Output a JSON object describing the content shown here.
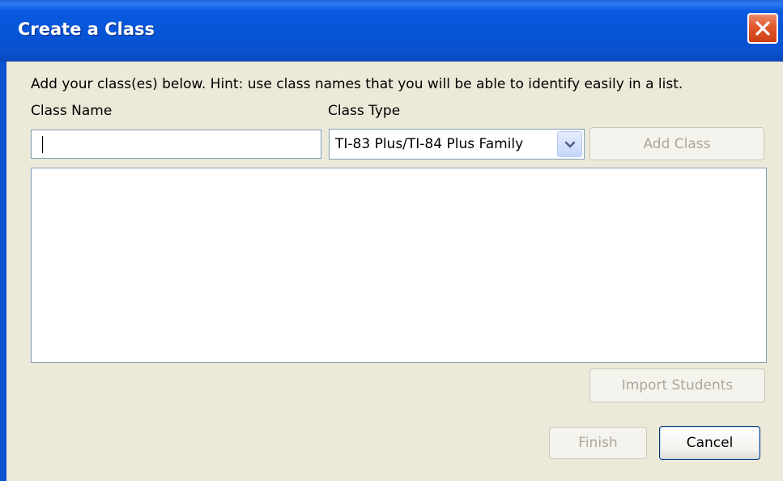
{
  "window": {
    "title": "Create a Class"
  },
  "form": {
    "hint": "Add your class(es) below.  Hint: use class names that you will be able to identify easily in a list.",
    "class_name_label": "Class Name",
    "class_name_value": "",
    "class_type_label": "Class Type",
    "class_type_selected": "TI-83 Plus/TI-84 Plus Family",
    "add_class_button": "Add Class"
  },
  "class_list": {
    "items": []
  },
  "buttons": {
    "import_students": "Import Students",
    "finish": "Finish",
    "cancel": "Cancel"
  },
  "colors": {
    "titlebar": "#0654d6",
    "client_bg": "#ece9d8",
    "close": "#e0582c",
    "disabled_text": "#aca899"
  },
  "icons": {
    "close": "close-icon",
    "dropdown": "chevron-down-icon"
  }
}
